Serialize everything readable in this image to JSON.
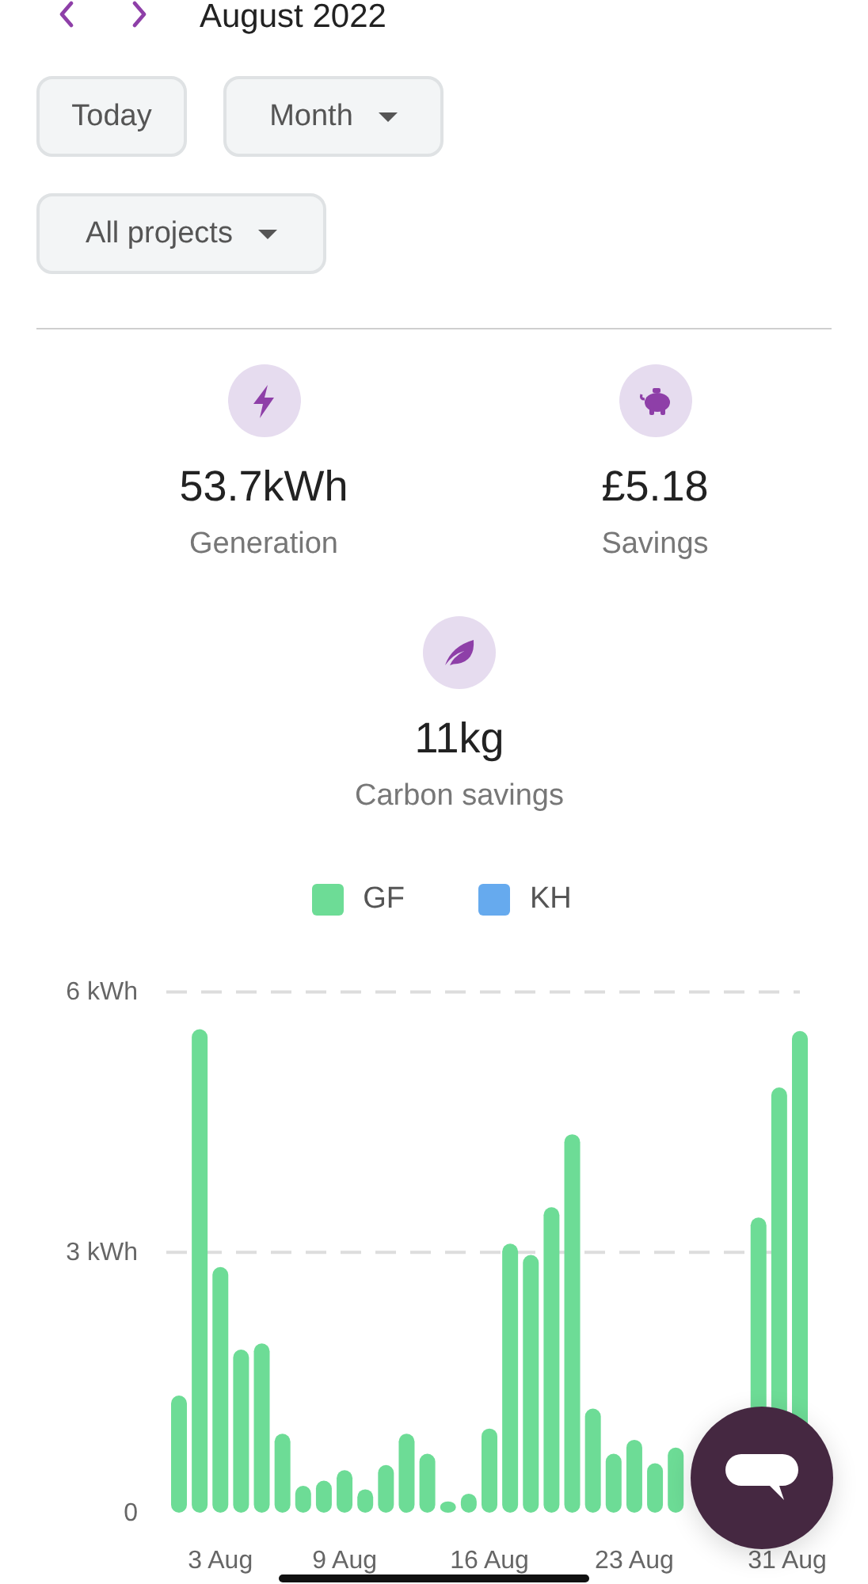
{
  "header": {
    "title": "August 2022"
  },
  "controls": {
    "today": "Today",
    "period": "Month",
    "projects": "All projects"
  },
  "stats": [
    {
      "kind": "bolt",
      "value": "53.7kWh",
      "label": "Generation"
    },
    {
      "kind": "piggy",
      "value": "£5.18",
      "label": "Savings"
    },
    {
      "kind": "leaf",
      "value": "11kg",
      "label": "Carbon savings"
    }
  ],
  "chart": {
    "chart_data": {
      "type": "bar",
      "categories": [
        null,
        null,
        "3 Aug",
        null,
        null,
        null,
        null,
        null,
        "9 Aug",
        null,
        null,
        null,
        null,
        null,
        null,
        "16 Aug",
        null,
        null,
        null,
        null,
        null,
        null,
        "23 Aug",
        null,
        null,
        null,
        null,
        null,
        null,
        null,
        "31 Aug"
      ],
      "series": [
        {
          "name": "GF",
          "color": "#6ddc96",
          "values": [
            1.35,
            5.57,
            2.83,
            1.88,
            1.95,
            0.91,
            0.31,
            0.37,
            0.49,
            0.27,
            0.55,
            0.91,
            0.68,
            0.13,
            0.22,
            0.97,
            3.1,
            2.97,
            3.52,
            4.36,
            1.2,
            0.68,
            0.84,
            0.57,
            0.75,
            null,
            null,
            null,
            3.4,
            4.9,
            5.55
          ]
        },
        {
          "name": "KH",
          "color": "#66aaee",
          "values": [
            0,
            0,
            0,
            0,
            0,
            0,
            0,
            0,
            0,
            0,
            0,
            0,
            0,
            0,
            0,
            0,
            0,
            0,
            0,
            0,
            0,
            0,
            0,
            0,
            0,
            0,
            0,
            0,
            0,
            0,
            0
          ]
        }
      ],
      "ylim": [
        0,
        6
      ],
      "yticks": [
        {
          "value": 0,
          "label": "0"
        },
        {
          "value": 3,
          "label": "3 kWh"
        },
        {
          "value": 6,
          "label": "6 kWh"
        }
      ]
    }
  }
}
